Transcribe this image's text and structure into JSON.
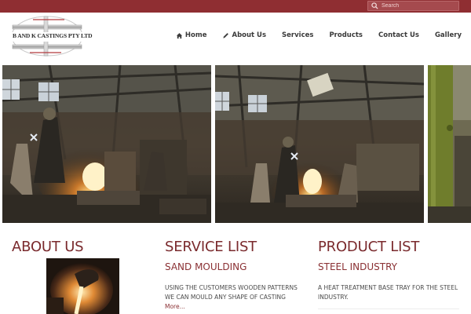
{
  "search": {
    "placeholder": "Search"
  },
  "logo": {
    "text": "B AND K CASTINGS PTY LTD"
  },
  "nav": {
    "items": [
      {
        "label": "Home",
        "icon": "home-icon"
      },
      {
        "label": "About Us",
        "icon": "pencil-icon"
      },
      {
        "label": "Services"
      },
      {
        "label": "Products"
      },
      {
        "label": "Contact Us"
      },
      {
        "label": "Gallery"
      }
    ]
  },
  "colors": {
    "topbar": "#8f2e32",
    "accent": "#7a2a2d",
    "nav_text": "#3a3a3a"
  },
  "about": {
    "title": "ABOUT US"
  },
  "services": {
    "title": "SERVICE LIST",
    "subtitle": "SAND MOULDING",
    "text": "USING THE CUSTOMERS WOODEN PATTERNS WE CAN MOULD ANY SHAPE OF CASTING",
    "more": "More..."
  },
  "products": {
    "title": "PRODUCT LIST",
    "subtitle": "STEEL INDUSTRY",
    "text": "A HEAT TREATMENT BASE TRAY FOR THE STEEL INDUSTRY."
  }
}
